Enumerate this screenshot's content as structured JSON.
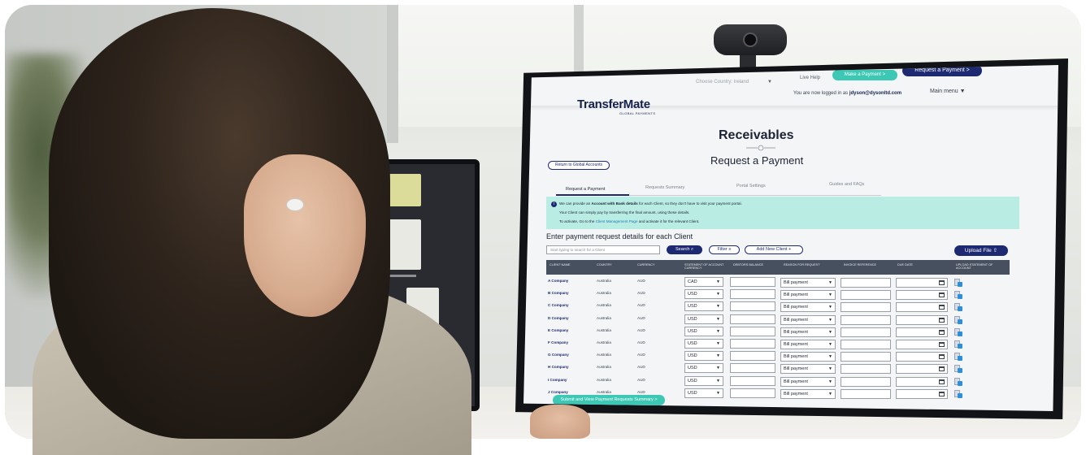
{
  "ui": {
    "brand": {
      "name": "TransferMate",
      "tagline": "GLOBAL PAYMENTS"
    },
    "header": {
      "country_select": "Choose Country: Ireland",
      "live_help": "Live Help",
      "make_payment": "Make a Payment  >",
      "request_payment": "Request a Payment  >",
      "logged_in_prefix": "You are now logged in as",
      "logged_in_user": "jdyson@dysonltd.com",
      "main_menu": "Main menu"
    },
    "page": {
      "title": "Receivables",
      "subtitle": "Request a Payment",
      "return_button": "Return to Global Accounts"
    },
    "tabs": [
      {
        "label": "Request a Payment",
        "active": true
      },
      {
        "label": "Requests Summary",
        "active": false
      },
      {
        "label": "Portal Settings",
        "active": false
      },
      {
        "label": "Guides and FAQs",
        "active": false
      }
    ],
    "info": {
      "line1_pre": "We can provide an",
      "line1_bold": "Account with Bank details",
      "line1_post": "for each Client, so they don't have to visit your payment portal.",
      "line2": "Your Client can simply pay by transferring the final amount, using these details.",
      "line3_pre": "To activate, Go to the",
      "line3_link": "Client Management Page",
      "line3_post": "and activate it for the relevant Client."
    },
    "section": {
      "title": "Enter payment request details for each Client",
      "search_placeholder": "Start typing to search for a Client",
      "search_button": "Search",
      "filter_button": "Filter",
      "add_client_button": "Add New Client  +",
      "upload_button": "Upload File"
    },
    "table": {
      "headers": {
        "client_name": "CLIENT NAME",
        "country": "COUNTRY",
        "currency": "CURRENCY",
        "statement_currency": "STATEMENT OF ACCOUNT CURRENCY",
        "debtors_balance": "DEBTORS BALANCE",
        "reason": "REASON FOR REQUEST",
        "invoice": "INVOICE REFERENCE",
        "due_date": "DUE DATE",
        "upload": "UPLOAD STATEMENT OF ACCOUNT"
      },
      "rows": [
        {
          "name": "A Company",
          "country": "Australia",
          "currency": "AUD",
          "soa_currency": "CAD",
          "reason": "Bill payment"
        },
        {
          "name": "B Company",
          "country": "Australia",
          "currency": "AUD",
          "soa_currency": "USD",
          "reason": "Bill payment"
        },
        {
          "name": "C Company",
          "country": "Australia",
          "currency": "AUD",
          "soa_currency": "USD",
          "reason": "Bill payment"
        },
        {
          "name": "D Company",
          "country": "Australia",
          "currency": "AUD",
          "soa_currency": "USD",
          "reason": "Bill payment"
        },
        {
          "name": "E Company",
          "country": "Australia",
          "currency": "AUD",
          "soa_currency": "USD",
          "reason": "Bill payment"
        },
        {
          "name": "F Company",
          "country": "Australia",
          "currency": "AUD",
          "soa_currency": "USD",
          "reason": "Bill payment"
        },
        {
          "name": "G Company",
          "country": "Australia",
          "currency": "AUD",
          "soa_currency": "USD",
          "reason": "Bill payment"
        },
        {
          "name": "H Company",
          "country": "Australia",
          "currency": "AUD",
          "soa_currency": "USD",
          "reason": "Bill payment"
        },
        {
          "name": "I Company",
          "country": "Australia",
          "currency": "AUD",
          "soa_currency": "USD",
          "reason": "Bill payment"
        },
        {
          "name": "J Company",
          "country": "Australia",
          "currency": "AUD",
          "soa_currency": "USD",
          "reason": "Bill payment"
        }
      ]
    },
    "submit_button": "Submit and View Payment Requests Summary  >"
  },
  "colors": {
    "navy": "#1d2a72",
    "teal": "#3cc8b4",
    "info_bg": "#b9ece3",
    "table_header": "#47505f"
  },
  "icons": [
    "search-icon",
    "filter-icon",
    "upload-icon",
    "calendar-icon",
    "info-icon",
    "chevron-down-icon",
    "webcam"
  ]
}
